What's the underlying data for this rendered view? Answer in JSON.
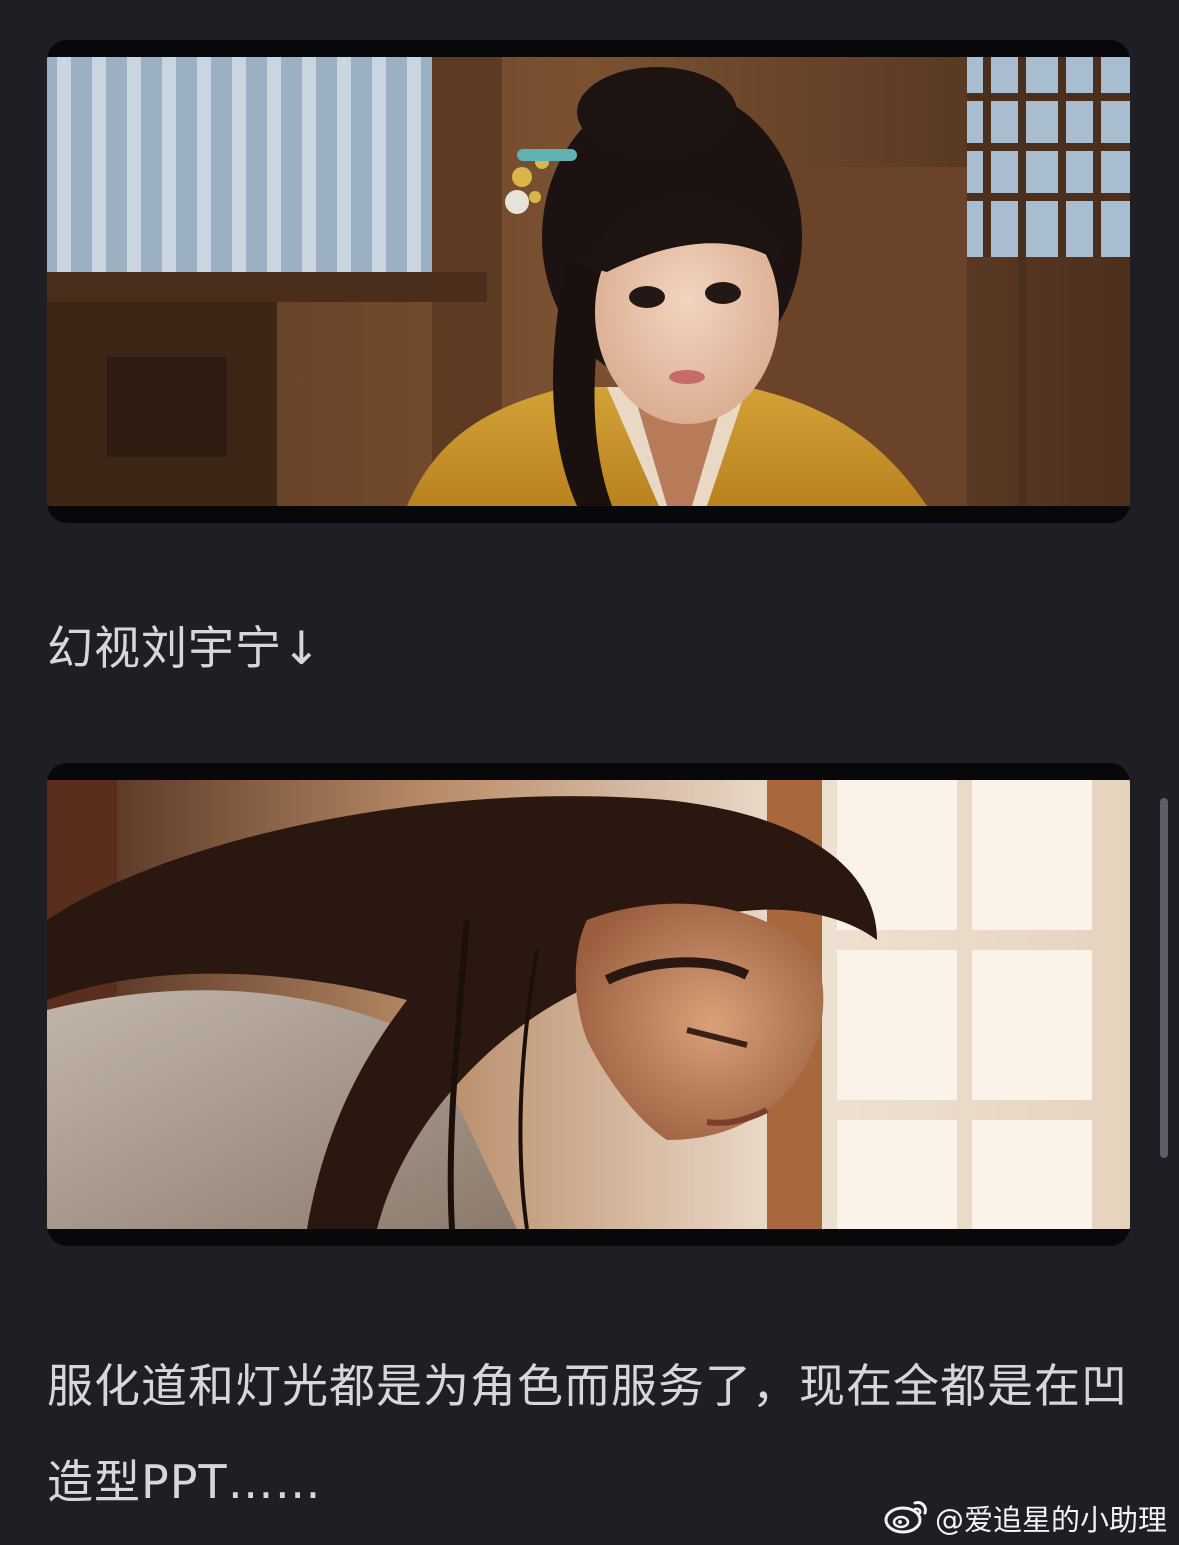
{
  "post": {
    "image_1": {
      "alt": ""
    },
    "caption_1": "幻视刘宇宁↓",
    "image_2": {
      "alt": ""
    },
    "caption_2": "服化道和灯光都是为角色而服务了，现在全都是在凹造型PPT……"
  },
  "watermark": {
    "icon": "weibo-logo-icon",
    "handle": "@爱追星的小助理"
  },
  "colors": {
    "background": "#1f1e24",
    "text": "#d7d6dc",
    "frame": "#08080a",
    "scrollbar": "#5f5e66"
  }
}
